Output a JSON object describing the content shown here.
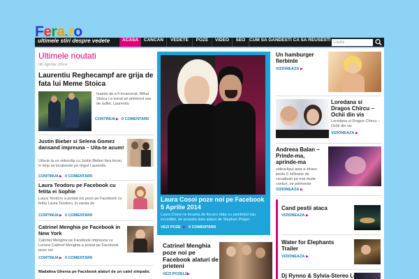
{
  "site": {
    "logo": "Fera.ro",
    "logo_letters": [
      "F",
      "e",
      "r",
      "a",
      ".",
      "r",
      "o"
    ],
    "tagline": "ultimele stiri despre vedete"
  },
  "nav": {
    "items": [
      "ACASA",
      "CANCAN",
      "VEDETE",
      "POZE",
      "VIDEO",
      "SEO",
      "CUM SA GANDESTI CA SA REUSESTI"
    ],
    "active": "ACASA",
    "search_placeholder": "Cauta"
  },
  "colors": {
    "accent": "#e0007a",
    "link": "#0a7ab3",
    "featured_bg": "#1fa3d8",
    "nav_bg": "#1a1a1a"
  },
  "left": {
    "section_title": "Ultimele noutati",
    "date": "06 Aprilie 2014",
    "main": {
      "title": "Laurentiu Reghecampf are grija de fata lui Meme Stoica",
      "excerpt": "Inainte de a fi incarcerat, Mihai Stoica l-a sunat pe prietenul sau de suflet, Laurentiu",
      "continue": "CONTINUA",
      "comments": "0 COMENTARII"
    },
    "posts": [
      {
        "title": "Justin Bieber si Selena Gomez dansand impreuna – Uita-te acum!",
        "excerpt": "Uita-te la un videoclip cu Justin Bieber fara tricou in timp se incalzeste pe ringul Laurentiu",
        "continue": "CONTINUA",
        "comments": "0 COMENTARII"
      },
      {
        "title": "Laura Teodoru pe Facebook cu fetita ei Sophie",
        "excerpt": "Laura Teodoru a postat noi poze pe Facebook cu fetita Laura Teodoru, in varsta de",
        "continue": "CONTINUA",
        "comments": "0 COMENTARII"
      },
      {
        "title": "Catrinel Menghia pe Facebook in New York",
        "excerpt": "Catrinel Menghia pe Facebook impreuna cu Lorena Catrinel Menghia a postat pe Facebook poze noi",
        "continue": "CONTINUA",
        "comments": "0 COMENTARII"
      }
    ],
    "last_title": "Madalina Gherea pe Facebook alaturi de un catel simpatic"
  },
  "featured": {
    "title": "Laura Cosoi poze noi pe Facebook 5 Aprilie 2014",
    "excerpt": "Laura Cosoi ne incanta de fiecare data cu zambetul sau incredibil, de aceasta data alaturi de Stephen Pelger",
    "more": "VEZI POZE",
    "comments": "0 COMENTARII"
  },
  "middle_post": {
    "title": "Catrinel Menghia poze noi pe Facebook alaturi de prieteni",
    "more": "VEZI POZELE"
  },
  "right": [
    {
      "title": "Un hamburger fierbinte",
      "more": "VIZIONEAZA"
    },
    {
      "title": "Loredana si Dragos Chircu – Ochii din vis",
      "excerpt": "Loredana si Dragos Chircu – Ochii din vis",
      "more": "VIZIONEAZA"
    },
    {
      "title": "Andreea Balan – Prinde-ma, aprinde-ma",
      "excerpt": "videoclipul asta a strans peste 5 milioane de vizualizari pe mai multe conturi, se potriveste",
      "more": "VIZIONEAZA"
    }
  ],
  "right_list": [
    {
      "title": "Cand pestii ataca",
      "more": "VIZIONEAZA"
    },
    {
      "title": "Water for Elephants Trailer",
      "more": "VIZIONEAZA"
    },
    {
      "title": "Dj Rynno & Sylvia-Stereo Love",
      "more": ""
    }
  ]
}
